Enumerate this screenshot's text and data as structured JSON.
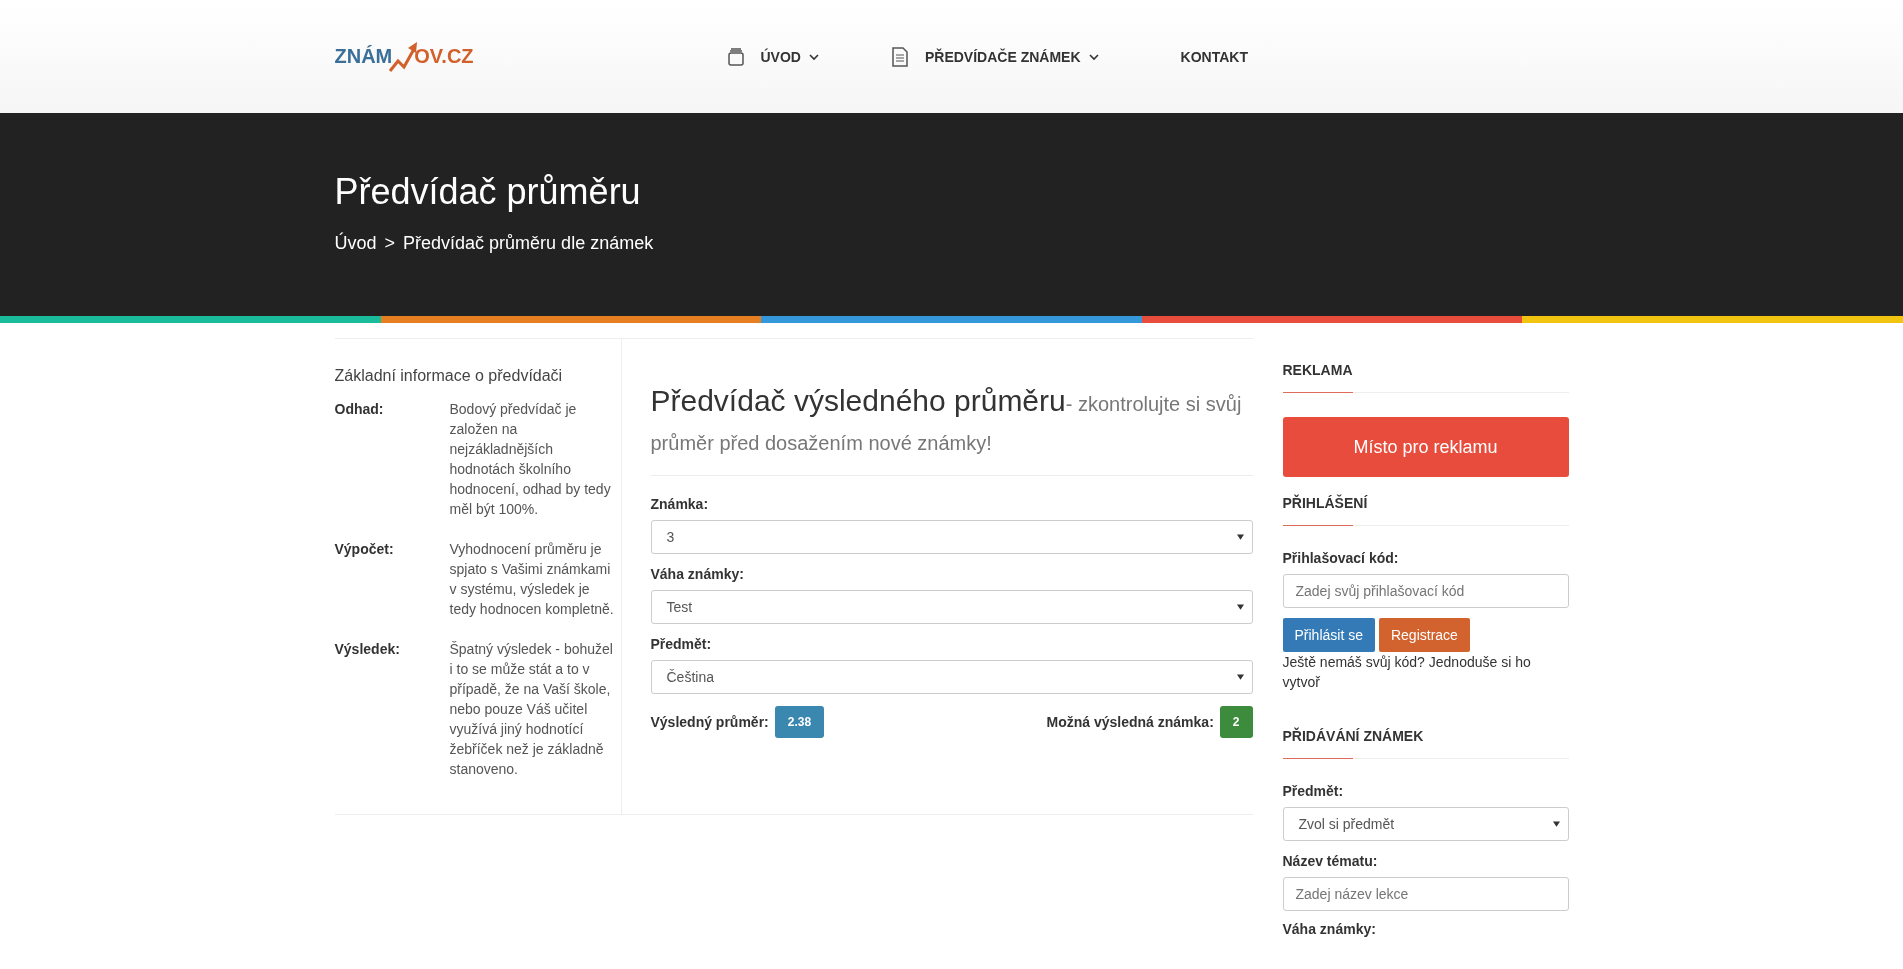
{
  "header": {
    "logo": {
      "left": "ZNÁM",
      "right": "OV.CZ"
    },
    "nav": [
      {
        "label": "ÚVOD",
        "kind": "box",
        "dropdown": true
      },
      {
        "label": "PŘEDVÍDAČE ZNÁMEK",
        "kind": "document",
        "dropdown": true
      },
      {
        "label": "KONTAKT",
        "kind": "none",
        "dropdown": false
      }
    ]
  },
  "hero": {
    "title": "Předvídač průměru",
    "breadcrumb": [
      {
        "label": "Úvod"
      },
      {
        "label": "Předvídač průměru dle známek"
      }
    ],
    "separator": ">"
  },
  "info": {
    "title": "Základní informace o předvídači",
    "items": [
      {
        "term": "Odhad:",
        "text": "Bodový předvídač je založen na nejzákladnějších hodnotách školního hodnocení, odhad by tedy měl být 100%."
      },
      {
        "term": "Výpočet:",
        "text": "Vyhodnocení průměru je spjato s Vašimi známkami v systému, výsledek je tedy hodnocen kompletně."
      },
      {
        "term": "Výsledek:",
        "text": "Špatný výsledek - bohužel i to se může stát a to v případě, že na Vaší škole, nebo pouze Váš učitel využívá jiný hodnotící žebříček než je základně stanoveno."
      }
    ]
  },
  "predictor": {
    "title": "Předvídač výsledného průměru",
    "subtitle": "- zkontrolujte si svůj průměr před dosažením nové známky!",
    "fields": [
      {
        "label": "Známka:",
        "value": "3"
      },
      {
        "label": "Váha známky:",
        "value": "Test"
      },
      {
        "label": "Předmět:",
        "value": "Čeština"
      }
    ],
    "result_average": {
      "label": "Výsledný průměr:",
      "value": "2.38"
    },
    "result_grade": {
      "label": "Možná výsledná známka:",
      "value": "2"
    }
  },
  "sidebar": {
    "ad": {
      "heading": "REKLAMA",
      "button": "Místo pro reklamu"
    },
    "login": {
      "heading": "PŘIHLÁŠENÍ",
      "label": "Přihlašovací kód:",
      "placeholder": "Zadej svůj přihlašovací kód",
      "login_button": "Přihlásit se",
      "register_button": "Registrace",
      "note": "Ještě nemáš svůj kód? Jednoduše si ho vytvoř"
    },
    "add": {
      "heading": "PŘIDÁVÁNÍ ZNÁMEK",
      "fields": [
        {
          "kind": "select",
          "label": "Předmět:",
          "value": "Zvol si předmět"
        },
        {
          "kind": "input",
          "label": "Název tématu:",
          "placeholder": "Zadej název lekce"
        },
        {
          "kind": "label",
          "label": "Váha známky:"
        }
      ]
    }
  }
}
